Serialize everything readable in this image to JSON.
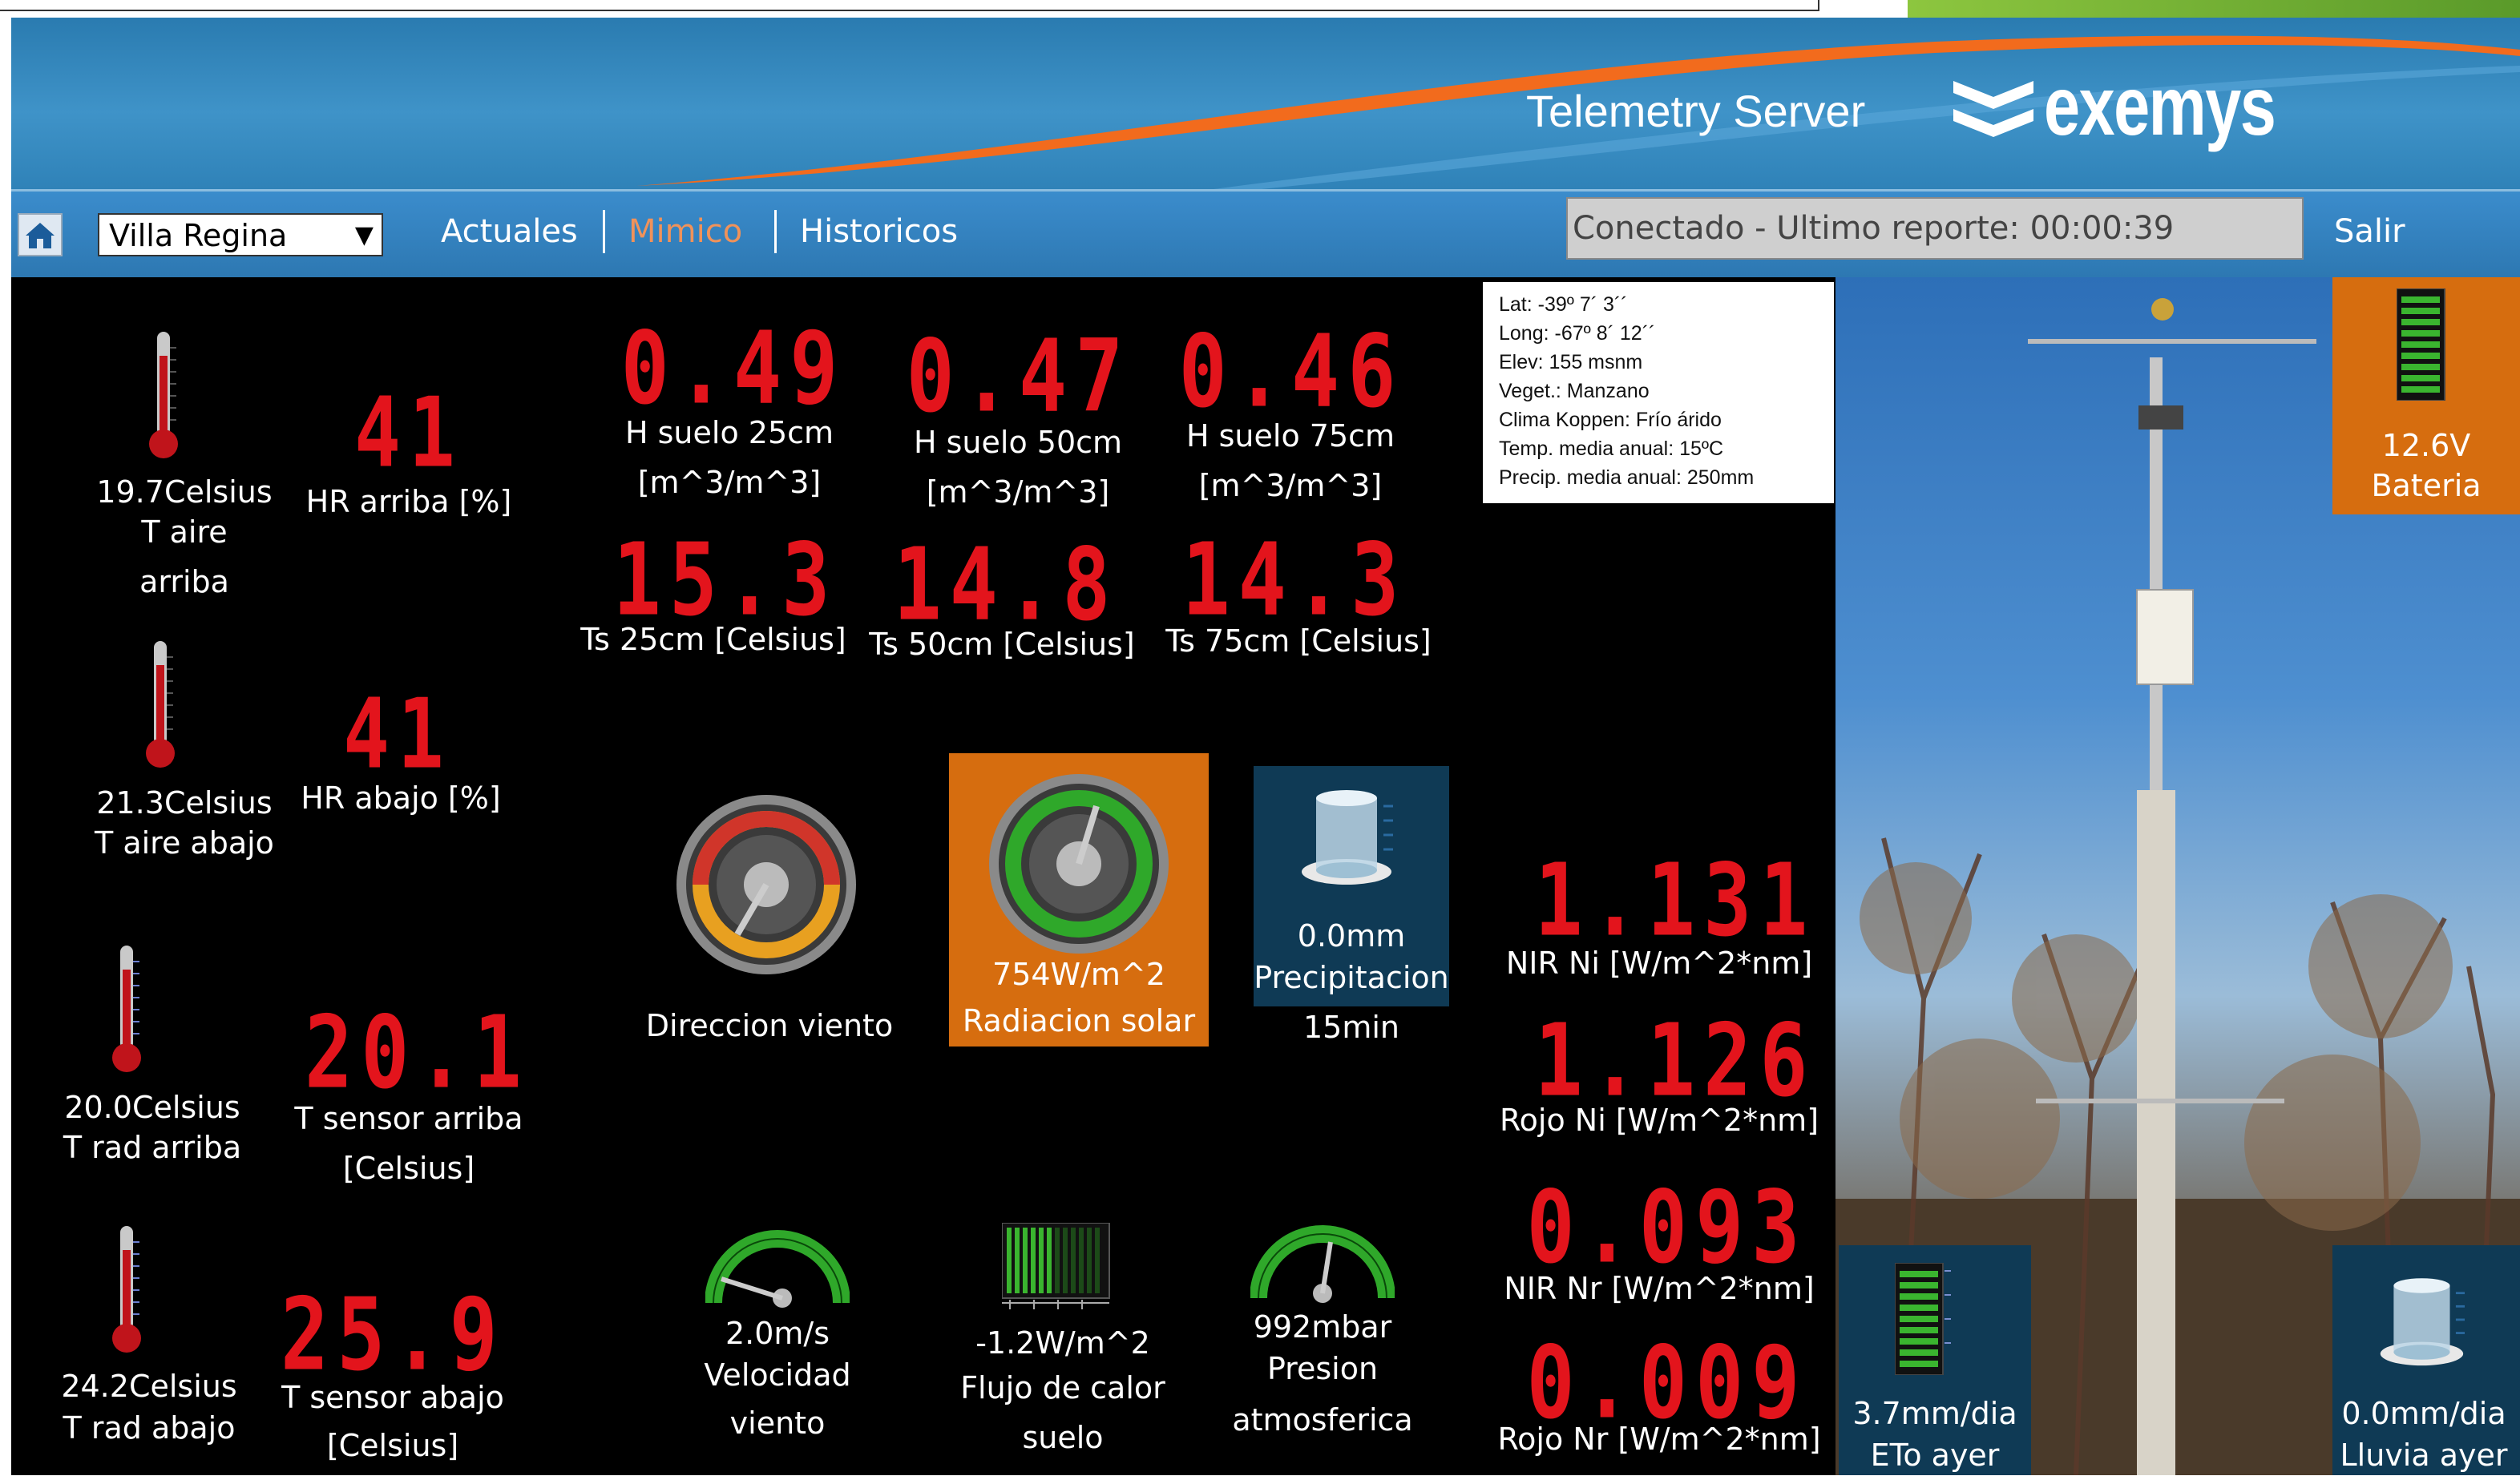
{
  "colors": {
    "header_blue": "#3f93c8",
    "nav_blue": "#2f82b8",
    "active_link": "#f0925a",
    "led_red": "#e3141c",
    "orange_panel": "#d66d0f",
    "teal_panel": "#0f3a55"
  },
  "header": {
    "product": "Telemetry Server",
    "brand": "exemys"
  },
  "nav": {
    "station": "Villa Regina",
    "links": [
      "Actuales",
      "Mimico",
      "Historicos"
    ],
    "active": "Mimico",
    "status": "Conectado - Ultimo reporte: 00:00:39",
    "logout": "Salir"
  },
  "left": {
    "t_aire_arriba": {
      "value": "19.7Celsius",
      "label1": "T aire",
      "label2": "arriba"
    },
    "hr_arriba": {
      "led": "41",
      "label": "HR arriba [%]"
    },
    "t_aire_abajo": {
      "value": "21.3Celsius",
      "label": "T aire abajo"
    },
    "hr_abajo": {
      "led": "41",
      "label": "HR abajo [%]"
    },
    "t_rad_arriba": {
      "value": "20.0Celsius",
      "label": "T rad arriba"
    },
    "t_sensor_arriba": {
      "led": "20.1",
      "label1": "T sensor arriba",
      "label2": "[Celsius]"
    },
    "t_rad_abajo": {
      "value": "24.2Celsius",
      "label": "T rad abajo"
    },
    "t_sensor_abajo": {
      "led": "25.9",
      "label1": "T sensor abajo",
      "label2": "[Celsius]"
    }
  },
  "soil": {
    "h25": {
      "led": "0.49",
      "label1": "H suelo 25cm",
      "label2": "[m^3/m^3]"
    },
    "h50": {
      "led": "0.47",
      "label1": "H suelo 50cm",
      "label2": "[m^3/m^3]"
    },
    "h75": {
      "led": "0.46",
      "label1": "H suelo 75cm",
      "label2": "[m^3/m^3]"
    },
    "ts25": {
      "led": "15.3",
      "label": "Ts 25cm [Celsius]"
    },
    "ts50": {
      "led": "14.8",
      "label": "Ts 50cm [Celsius]"
    },
    "ts75": {
      "led": "14.3",
      "label": "Ts 75cm [Celsius]"
    }
  },
  "info": [
    "Lat: -39º 7´ 3´´",
    "Long: -67º 8´ 12´´",
    "Elev: 155 msnm",
    "Veget.: Manzano",
    "Clima Koppen: Frío árido",
    "Temp. media anual: 15ºC",
    "Precip. media anual: 250mm"
  ],
  "gauges": {
    "wind_dir": {
      "label": "Direccion viento"
    },
    "solar": {
      "value": "754W/m^2",
      "label": "Radiacion solar"
    },
    "precip": {
      "value": "0.0mm",
      "label1": "Precipitacion",
      "label2": "15min"
    },
    "wind_speed": {
      "value": "2.0m/s",
      "label1": "Velocidad",
      "label2": "viento"
    },
    "heat_flux": {
      "value": "-1.2W/m^2",
      "label1": "Flujo de calor",
      "label2": "suelo"
    },
    "pressure": {
      "value": "992mbar",
      "label1": "Presion",
      "label2": "atmosferica"
    }
  },
  "radiation": {
    "nir_ni": {
      "led": "1.131",
      "label": "NIR Ni [W/m^2*nm]"
    },
    "rojo_ni": {
      "led": "1.126",
      "label": "Rojo Ni [W/m^2*nm]"
    },
    "nir_nr": {
      "led": "0.093",
      "label": "NIR Nr [W/m^2*nm]"
    },
    "rojo_nr": {
      "led": "0.009",
      "label": "Rojo Nr [W/m^2*nm]"
    }
  },
  "photo_panels": {
    "battery": {
      "value": "12.6V",
      "label": "Bateria"
    },
    "eto": {
      "value": "3.7mm/dia",
      "label": "ETo ayer"
    },
    "lluvia": {
      "value": "0.0mm/dia",
      "label": "Lluvia ayer"
    }
  }
}
